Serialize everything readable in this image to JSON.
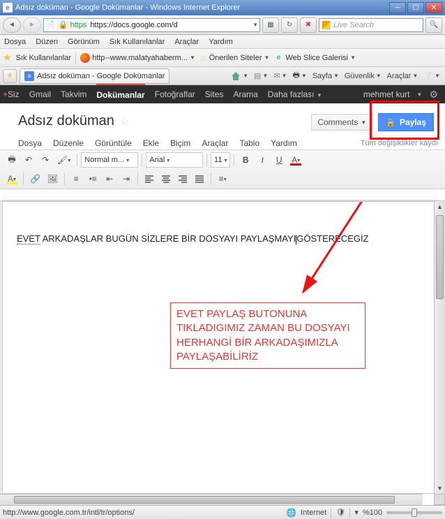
{
  "window": {
    "title": "Adsız doküman - Google Dokümanlar - Windows Internet Explorer"
  },
  "address": {
    "scheme_icon": "🔒",
    "url": "https://docs.google.com/d",
    "search_placeholder": "Live Search"
  },
  "ie_menu": [
    "Dosya",
    "Düzen",
    "Görünüm",
    "Sık Kullanılanlar",
    "Araçlar",
    "Yardım"
  ],
  "bookmarks": {
    "fav_label": "Sık Kullanılanlar",
    "items": [
      {
        "label": "http--www.malatyahaberm..."
      },
      {
        "label": "Önerilen Siteler"
      },
      {
        "label": "Web Slice Galerisi"
      }
    ]
  },
  "tab": {
    "title": "Adsız doküman - Google Dokümanlar"
  },
  "ie_cmd": {
    "home": "⌂",
    "feeds": "▦",
    "mail": "✉",
    "print": "⎙",
    "page": "Sayfa",
    "safety": "Güvenlik",
    "tools": "Araçlar",
    "help": "❔"
  },
  "gbar": {
    "items": [
      "+Siz",
      "Gmail",
      "Takvim",
      "Dokümanlar",
      "Fotoğraflar",
      "Sites",
      "Arama",
      "Daha fazlası"
    ],
    "active_index": 3,
    "user": "mehmet kurt"
  },
  "doc": {
    "title": "Adsız doküman",
    "comments": "Comments",
    "share": "Paylaş",
    "menu": [
      "Dosya",
      "Düzenle",
      "Görüntüle",
      "Ekle",
      "Biçim",
      "Araçlar",
      "Tablo",
      "Yardım"
    ],
    "status": "Tüm değişiklikler kaydı"
  },
  "toolbar": {
    "style": "Normal m...",
    "font": "Arial",
    "size": "11",
    "bold": "B",
    "italic": "I",
    "under": "U",
    "color": "A",
    "hl": "A"
  },
  "body": {
    "line1a": "EVET",
    "line1b": " ARKADAŞLAR  BUGÜN SİZLERE BİR DOSYAYI PAYLAŞMAYI",
    "line1c": "GÖSTERECEGİZ",
    "annot": "EVET PAYLAŞ BUTONUNA TIKLADIGIMIZ ZAMAN BU DOSYAYI HERHANGİ BİR ARKADAŞIMIZLA PAYLAŞABİLİRİZ"
  },
  "status": {
    "url": "http://www.google.com.tr/intl/tr/options/",
    "zone": "Internet",
    "zoom": "%100"
  }
}
